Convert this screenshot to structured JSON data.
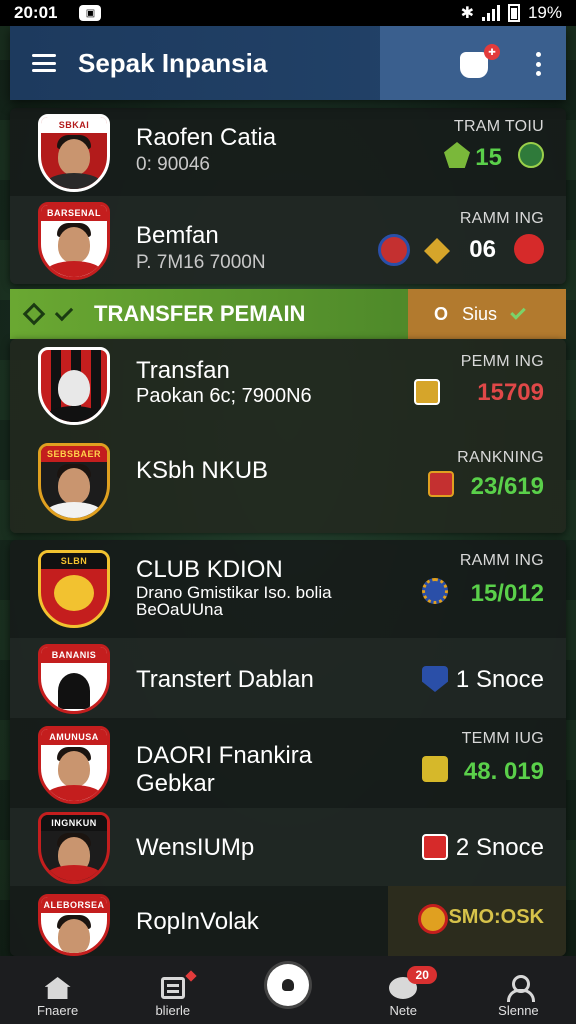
{
  "status_bar": {
    "time": "20:01",
    "battery": "19%"
  },
  "app": {
    "title": "Sepak Inpansia"
  },
  "card1": {
    "rows": [
      {
        "crest_text": "SBKAI",
        "name": "Raofen Catia",
        "sub": "0: 90046",
        "label": "TRAM TOIU",
        "value": "15"
      },
      {
        "crest_text": "BARSENAL",
        "name": "Bemfan",
        "sub": "P. 7M16 7000N",
        "label": "RAMM ING",
        "value": "06"
      }
    ]
  },
  "banner": {
    "title": "TRANSFER PEMAIN",
    "right_o": "O",
    "right_text": "Sius"
  },
  "card2": {
    "rows": [
      {
        "crest_text": "",
        "name": "Transfan",
        "sub": "Paokan 6c; 7900N6",
        "label": "PEMM ING",
        "value": "15709"
      },
      {
        "crest_text": "SEBSBAER",
        "name": "KSbh NKUB",
        "sub": "",
        "label": "RANKNING",
        "value": "23/619"
      }
    ]
  },
  "card3": {
    "rows": [
      {
        "crest_text": "SLBN",
        "name": "CLUB KDION",
        "sub": "Drano Gmistikar Iso. bolia BeOaUUna",
        "label": "RAMM ING",
        "value": "15/012"
      },
      {
        "crest_text": "BANANIS",
        "name": "Transtert Dablan",
        "sub": "",
        "label": "",
        "value": "1 Snoce"
      },
      {
        "crest_text": "AMUNUSA",
        "name": "DAORI Fnankira Gebkar",
        "sub": "",
        "label": "TEMM IUG",
        "value": "48. 019"
      },
      {
        "crest_text": "INGNKUN",
        "name": "WensIUMp",
        "sub": "",
        "label": "",
        "value": "2 Snoce"
      },
      {
        "crest_text": "ALEBORSEA",
        "name": "RopInVolak",
        "sub": "",
        "label": "",
        "value": "SMO:OSK"
      }
    ]
  },
  "bottom_nav": {
    "items": [
      {
        "label": "Fnaere"
      },
      {
        "label": "blierle"
      },
      {
        "label": ""
      },
      {
        "label": "Nete"
      },
      {
        "label": "Slenne"
      }
    ],
    "chat_badge": "20"
  },
  "colors": {
    "accent_green": "#6aa832",
    "value_green": "#5ad04a",
    "value_red": "#e04848",
    "banner_orange": "#b27a2e"
  }
}
